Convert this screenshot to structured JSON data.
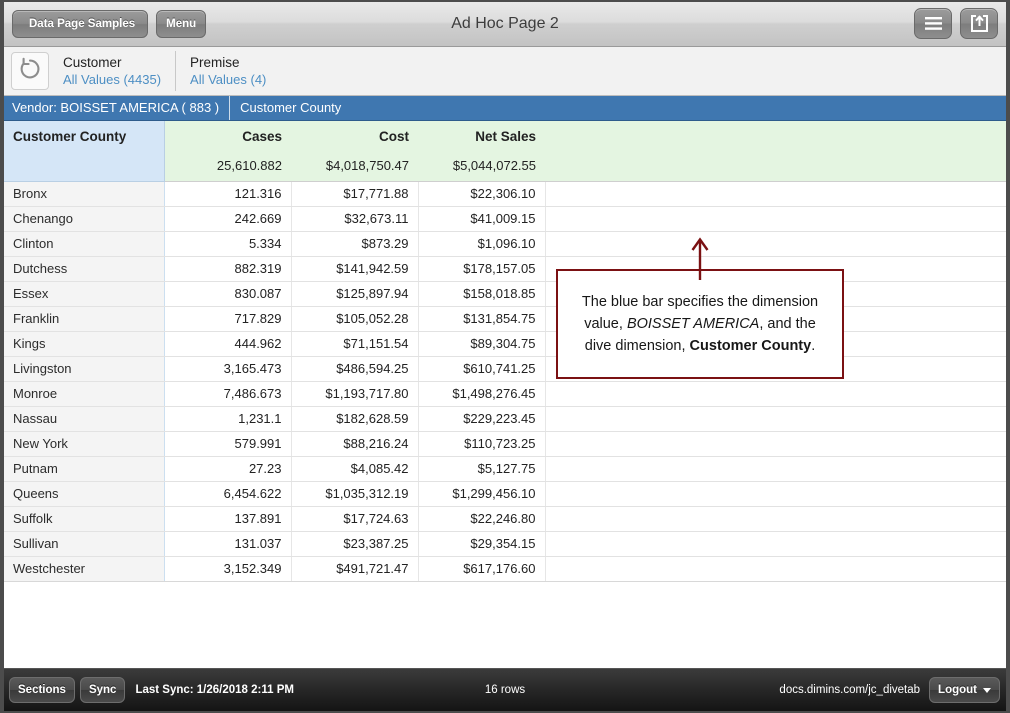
{
  "titlebar": {
    "back_label": "Data Page Samples",
    "menu_label": "Menu",
    "title": "Ad Hoc Page 2",
    "hamburger_icon": "hamburger-menu-icon",
    "share_icon": "share-export-icon"
  },
  "filterbar": {
    "refresh_icon": "refresh-circular-arrow-icon",
    "filters": [
      {
        "name": "Customer",
        "value": "All Values (4435)"
      },
      {
        "name": "Premise",
        "value": "All Values (4)"
      }
    ]
  },
  "dimension_bar": {
    "vendor": "Vendor: BOISSET AMERICA  ( 883 )",
    "dive_dimension": "Customer County"
  },
  "table": {
    "columns": [
      "Customer County",
      "Cases",
      "Cost",
      "Net Sales",
      ""
    ],
    "totals": [
      "",
      "25,610.882",
      "$4,018,750.47",
      "$5,044,072.55",
      ""
    ],
    "rows": [
      {
        "county": "Bronx",
        "cases": "121.316",
        "cost": "$17,771.88",
        "net_sales": "$22,306.10"
      },
      {
        "county": "Chenango",
        "cases": "242.669",
        "cost": "$32,673.11",
        "net_sales": "$41,009.15"
      },
      {
        "county": "Clinton",
        "cases": "5.334",
        "cost": "$873.29",
        "net_sales": "$1,096.10"
      },
      {
        "county": "Dutchess",
        "cases": "882.319",
        "cost": "$141,942.59",
        "net_sales": "$178,157.05"
      },
      {
        "county": "Essex",
        "cases": "830.087",
        "cost": "$125,897.94",
        "net_sales": "$158,018.85"
      },
      {
        "county": "Franklin",
        "cases": "717.829",
        "cost": "$105,052.28",
        "net_sales": "$131,854.75"
      },
      {
        "county": "Kings",
        "cases": "444.962",
        "cost": "$71,151.54",
        "net_sales": "$89,304.75"
      },
      {
        "county": "Livingston",
        "cases": "3,165.473",
        "cost": "$486,594.25",
        "net_sales": "$610,741.25"
      },
      {
        "county": "Monroe",
        "cases": "7,486.673",
        "cost": "$1,193,717.80",
        "net_sales": "$1,498,276.45"
      },
      {
        "county": "Nassau",
        "cases": "1,231.1",
        "cost": "$182,628.59",
        "net_sales": "$229,223.45"
      },
      {
        "county": "New York",
        "cases": "579.991",
        "cost": "$88,216.24",
        "net_sales": "$110,723.25"
      },
      {
        "county": "Putnam",
        "cases": "27.23",
        "cost": "$4,085.42",
        "net_sales": "$5,127.75"
      },
      {
        "county": "Queens",
        "cases": "6,454.622",
        "cost": "$1,035,312.19",
        "net_sales": "$1,299,456.10"
      },
      {
        "county": "Suffolk",
        "cases": "137.891",
        "cost": "$17,724.63",
        "net_sales": "$22,246.80"
      },
      {
        "county": "Sullivan",
        "cases": "131.037",
        "cost": "$23,387.25",
        "net_sales": "$29,354.15"
      },
      {
        "county": "Westchester",
        "cases": "3,152.349",
        "cost": "$491,721.47",
        "net_sales": "$617,176.60"
      }
    ]
  },
  "callout": {
    "part1": "The blue bar specifies the dimension value, ",
    "emphasis_italic": "BOISSET AMERICA",
    "part2": ", and the dive dimension, ",
    "emphasis_bold": "Customer County",
    "part3": ".",
    "border_color": "#7b1113",
    "arrow_color": "#7b1113"
  },
  "footer": {
    "sections_label": "Sections",
    "sync_label": "Sync",
    "last_sync": "Last Sync: 1/26/2018 2:11 PM",
    "rows_count": "16 rows",
    "host": "docs.dimins.com/jc_divetab",
    "logout_label": "Logout",
    "logout_caret_icon": "caret-down-icon"
  },
  "colors": {
    "blue_bar": "#3f77b0",
    "header_green": "#e4f5e1",
    "header_blue": "#d5e6f7",
    "link_blue": "#4d8fc4"
  }
}
